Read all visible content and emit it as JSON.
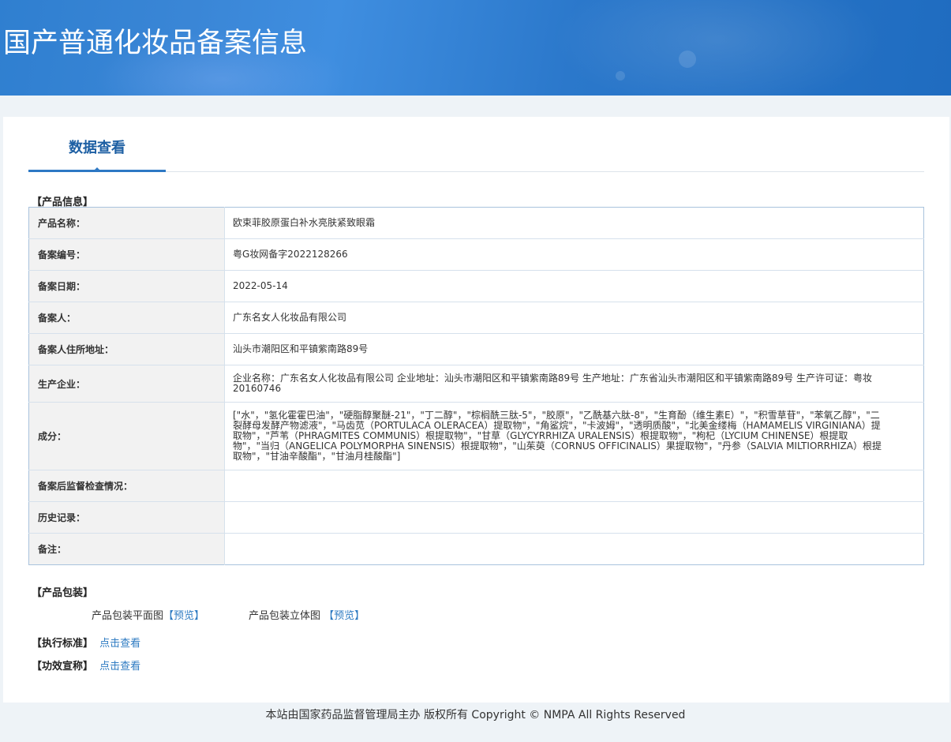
{
  "header": {
    "title": "国产普通化妆品备案信息"
  },
  "tabs": [
    {
      "label": "数据查看"
    }
  ],
  "product_info": {
    "section_label": "【产品信息】",
    "rows": [
      {
        "key": "产品名称：",
        "value": "欧束菲胶原蛋白补水亮肤紧致眼霜"
      },
      {
        "key": "备案编号：",
        "value": "粤G妆网备字2022128266"
      },
      {
        "key": "备案日期：",
        "value": "2022-05-14"
      },
      {
        "key": "备案人：",
        "value": "广东名女人化妆品有限公司"
      },
      {
        "key": "备案人住所地址：",
        "value": "汕头市潮阳区和平镇紫南路89号"
      },
      {
        "key": "生产企业：",
        "value": "企业名称：广东名女人化妆品有限公司 企业地址：汕头市潮阳区和平镇紫南路89号 生产地址：广东省汕头市潮阳区和平镇紫南路89号 生产许可证：粤妆20160746"
      },
      {
        "key": "成分：",
        "value": "[\"水\"，\"氢化霍霍巴油\"，\"硬脂醇聚醚-21\"，\"丁二醇\"，\"棕榈酰三肽-5\"，\"胶原\"，\"乙酰基六肽-8\"，\"生育酚（维生素E）\"，\"积雪草苷\"，\"苯氧乙醇\"，\"二裂酵母发酵产物滤液\"，\"马齿苋（PORTULACA OLERACEA）提取物\"，\"角鲨烷\"，\"卡波姆\"，\"透明质酸\"，\"北美金缕梅（HAMAMELIS VIRGINIANA）提取物\"，\"芦苇（PHRAGMITES COMMUNIS）根提取物\"，\"甘草（GLYCYRRHIZA URALENSIS）根提取物\"，\"枸杞（LYCIUM CHINENSE）根提取物\"，\"当归（ANGELICA POLYMORPHA SINENSIS）根提取物\"，\"山茱萸（CORNUS OFFICINALIS）果提取物\"，\"丹参（SALVIA MILTIORRHIZA）根提取物\"，\"甘油辛酸酯\"，\"甘油月桂酸酯\"]"
      },
      {
        "key": "备案后监督检查情况：",
        "value": ""
      },
      {
        "key": "历史记录：",
        "value": ""
      },
      {
        "key": "备注：",
        "value": ""
      }
    ]
  },
  "packaging": {
    "section_label": "【产品包装】",
    "flat_label": "产品包装平面图",
    "flat_link": "【预览】",
    "solid_label": "产品包装立体图",
    "solid_link": "【预览】"
  },
  "standard": {
    "label": "【执行标准】",
    "link": "点击查看"
  },
  "efficacy": {
    "label": "【功效宣称】",
    "link": "点击查看"
  },
  "footer": {
    "text": "本站由国家药品监督管理局主办 版权所有 Copyright © NMPA All Rights Reserved"
  },
  "colors": {
    "header_blue": "#2f7fd0",
    "link_blue": "#2e7bc2",
    "tab_blue": "#2d78c4",
    "table_border": "#a9c3dd"
  }
}
